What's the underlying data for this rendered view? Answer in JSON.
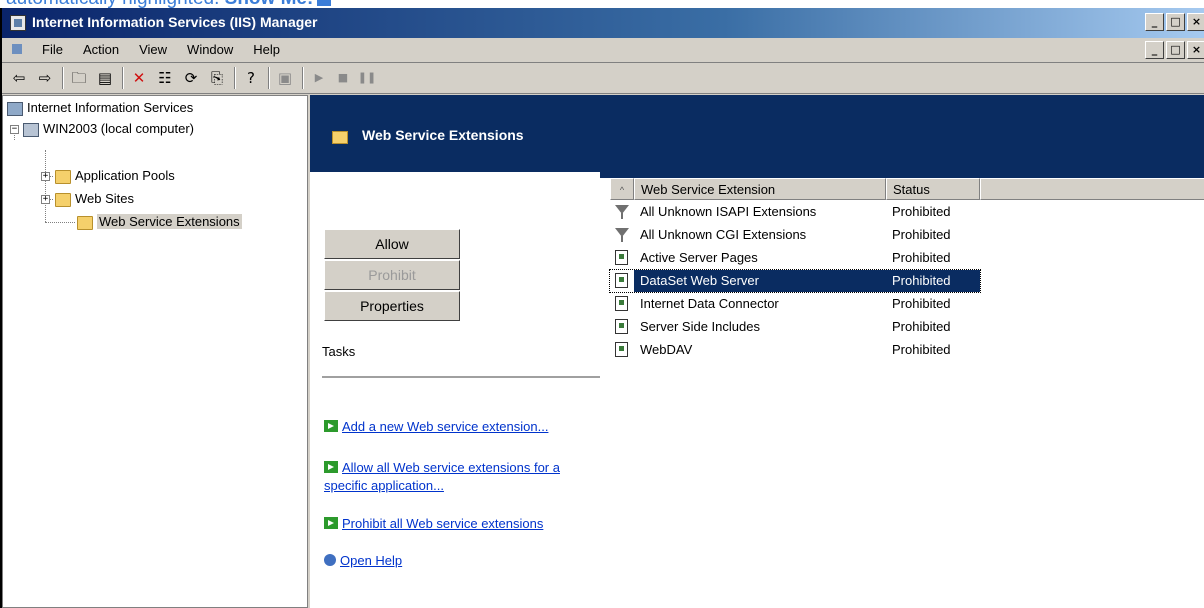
{
  "caption": {
    "text": "automatically highlighted.",
    "link": "Show Me!"
  },
  "window": {
    "title": "Internet Information Services (IIS) Manager",
    "buttons": [
      "_",
      "□",
      "×"
    ]
  },
  "menu": {
    "items": [
      {
        "label": "File"
      },
      {
        "label": "Action"
      },
      {
        "label": "View"
      },
      {
        "label": "Window"
      },
      {
        "label": "Help"
      }
    ]
  },
  "toolbar": {
    "buttons": [
      "back-arrow-icon",
      "forward-arrow-icon",
      "up-folder-icon",
      "show-hide-tree-icon",
      "delete-icon",
      "properties-icon",
      "refresh-icon",
      "export-list-icon",
      "help-icon",
      "console-icon",
      "play-icon",
      "stop-icon",
      "pause-icon"
    ]
  },
  "tree": {
    "root": "Internet Information Services",
    "computer": "WIN2003 (local computer)",
    "children": [
      "Application Pools",
      "Web Sites",
      "Web Service Extensions"
    ],
    "selected": "Web Service Extensions"
  },
  "header": {
    "title": "Web Service Extensions"
  },
  "actions": {
    "allow": "Allow",
    "prohibit": "Prohibit",
    "properties": "Properties"
  },
  "tasks": {
    "label": "Tasks",
    "links": [
      "Add a new Web service extension...",
      "Allow all Web service extensions for a specific application...",
      "Prohibit all Web service extensions",
      "Open Help"
    ]
  },
  "list": {
    "columns": {
      "sort": "^",
      "name": "Web Service Extension",
      "status": "Status"
    },
    "rows": [
      {
        "name": "All Unknown ISAPI Extensions",
        "status": "Prohibited",
        "icon": "filter-icon"
      },
      {
        "name": "All Unknown CGI Extensions",
        "status": "Prohibited",
        "icon": "filter-icon"
      },
      {
        "name": "Active Server Pages",
        "status": "Prohibited",
        "icon": "extension-page-icon"
      },
      {
        "name": "DataSet Web Server",
        "status": "Prohibited",
        "icon": "extension-page-icon"
      },
      {
        "name": "Internet Data Connector",
        "status": "Prohibited",
        "icon": "extension-page-icon"
      },
      {
        "name": "Server Side Includes",
        "status": "Prohibited",
        "icon": "extension-page-icon"
      },
      {
        "name": "WebDAV",
        "status": "Prohibited",
        "icon": "extension-page-icon"
      }
    ],
    "selected_index": 3
  },
  "colors": {
    "header_band": "#0a2c61",
    "title_bar_start": "#0a246a",
    "link": "#0033cc",
    "selection": "#0a2c61"
  }
}
